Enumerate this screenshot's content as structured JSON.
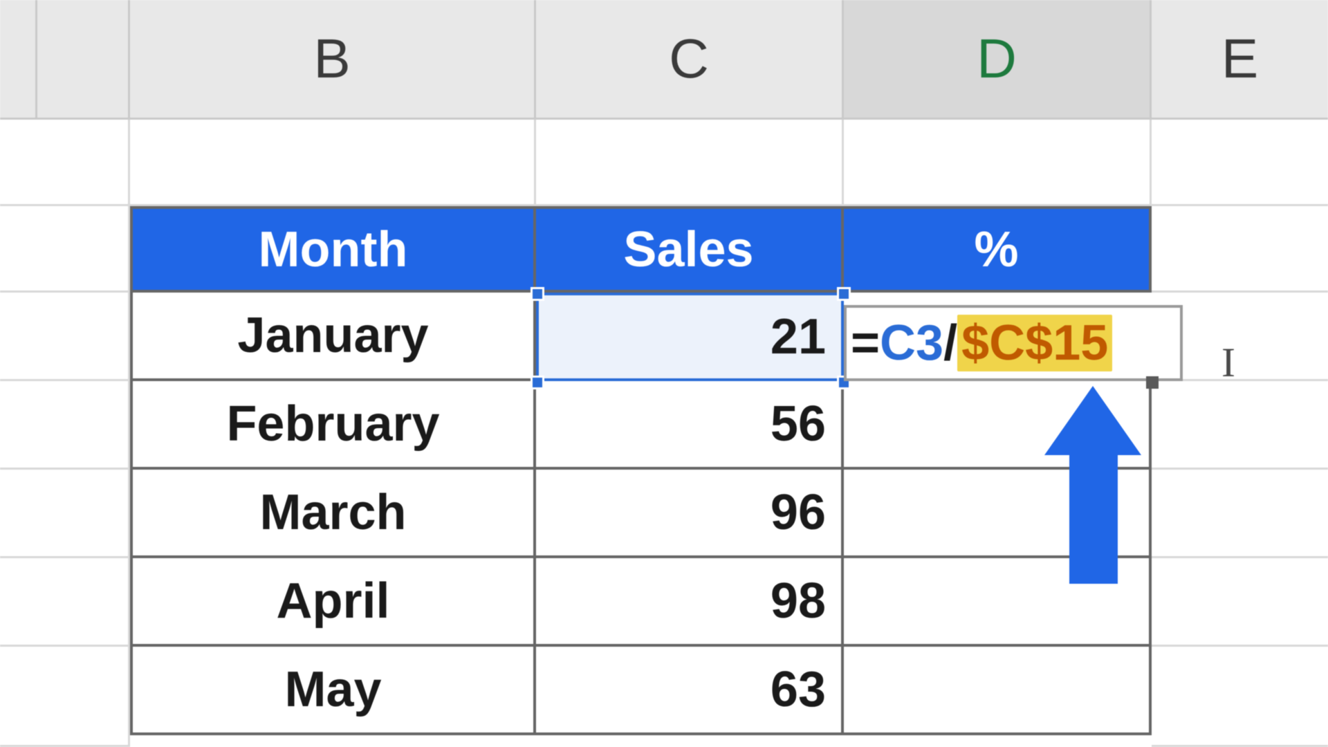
{
  "columns": {
    "A": "",
    "B": "B",
    "C": "C",
    "D": "D",
    "E": "E"
  },
  "table": {
    "headers": {
      "month": "Month",
      "sales": "Sales",
      "pct": "%"
    },
    "rows": [
      {
        "month": "January",
        "sales": "21"
      },
      {
        "month": "February",
        "sales": "56"
      },
      {
        "month": "March",
        "sales": "96"
      },
      {
        "month": "April",
        "sales": "98"
      },
      {
        "month": "May",
        "sales": "63"
      }
    ]
  },
  "formula": {
    "eq": "=",
    "ref1": "C3",
    "op": "/",
    "ref2": "$C$15"
  },
  "cursor_glyph": "I"
}
